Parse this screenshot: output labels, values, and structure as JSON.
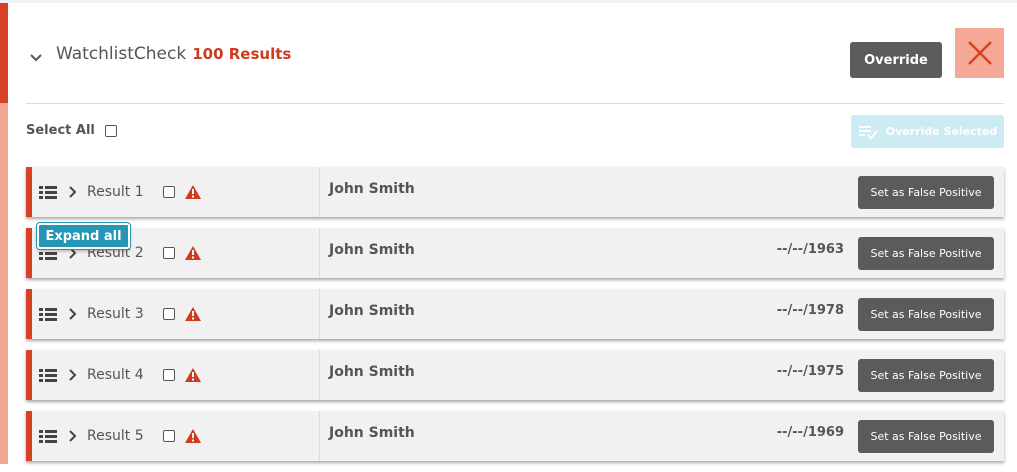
{
  "header": {
    "title": "WatchlistCheck",
    "results_count": "100 Results",
    "override_label": "Override"
  },
  "toolbar": {
    "select_all_label": "Select All",
    "override_selected_label": "Override Selected"
  },
  "tooltip": {
    "label": "Expand all"
  },
  "rows": [
    {
      "label": "Result 1",
      "name": "John Smith",
      "dob": "",
      "button": "Set as False Positive"
    },
    {
      "label": "Result 2",
      "name": "John Smith",
      "dob": "--/--/1963",
      "button": "Set as False Positive"
    },
    {
      "label": "Result 3",
      "name": "John Smith",
      "dob": "--/--/1978",
      "button": "Set as False Positive"
    },
    {
      "label": "Result 4",
      "name": "John Smith",
      "dob": "--/--/1975",
      "button": "Set as False Positive"
    },
    {
      "label": "Result 5",
      "name": "John Smith",
      "dob": "--/--/1969",
      "button": "Set as False Positive"
    }
  ],
  "icons": {
    "collapse": "chevron-down-icon",
    "close": "close-icon",
    "override_selected": "list-check-icon",
    "row_list": "list-icon",
    "row_expand": "chevron-right-icon",
    "row_warning": "warning-icon"
  },
  "colors": {
    "accent_red": "#d94126",
    "accent_pink": "#f2a593",
    "results_red": "#d03a1f",
    "button_dark": "#5b5b5b",
    "override_selected_bg": "#cdebf3",
    "tooltip_bg": "#2596b5"
  }
}
